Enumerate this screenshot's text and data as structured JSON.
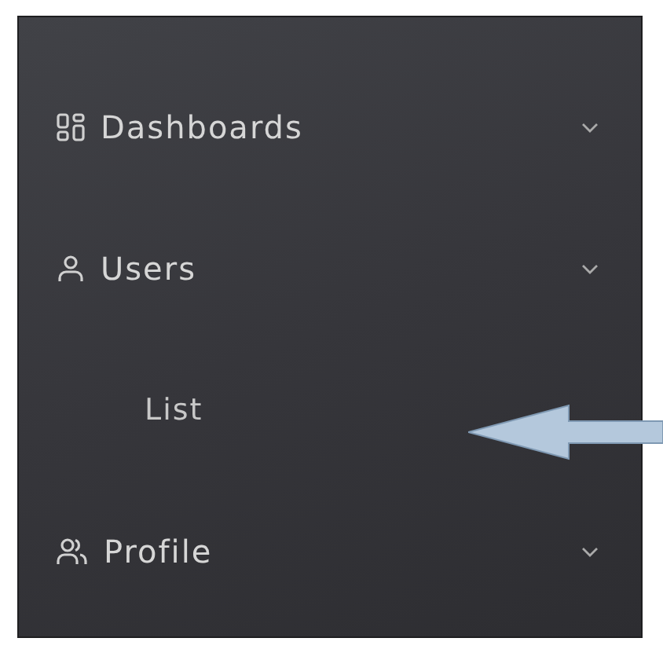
{
  "sidebar": {
    "items": [
      {
        "label": "Dashboards"
      },
      {
        "label": "Users",
        "children": [
          {
            "label": "List"
          }
        ]
      },
      {
        "label": "Profile"
      }
    ]
  }
}
